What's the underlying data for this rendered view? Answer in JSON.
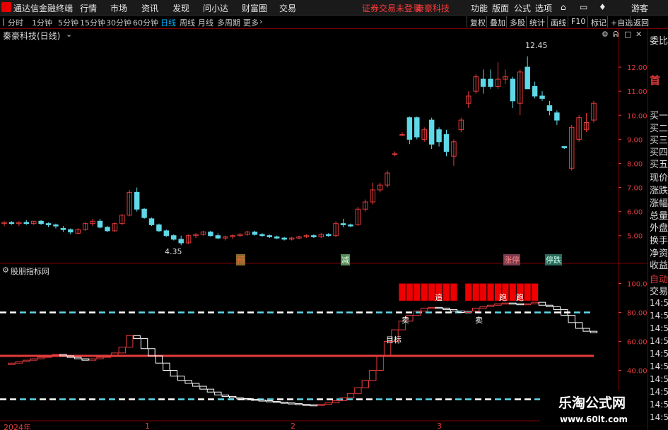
{
  "app_title": "通达信金融终端",
  "menu": [
    "行情",
    "市场",
    "资讯",
    "发现",
    "问小达",
    "财富圈",
    "交易"
  ],
  "notice": "证券交易未登录",
  "stock_title": "秦豪科技",
  "right_menu": [
    "功能",
    "版面",
    "公式",
    "选项"
  ],
  "guest": "游客",
  "periods": [
    "分时",
    "1分钟",
    "5分钟",
    "15分钟",
    "30分钟",
    "60分钟",
    "日线",
    "周线",
    "月线",
    "多周期",
    "更多"
  ],
  "active_period": "日线",
  "tool_buttons": [
    "复权",
    "叠加",
    "多股",
    "统计",
    "画线",
    "F10",
    "标记",
    "+自选",
    "返回"
  ],
  "chart_name": "秦豪科技(日线)",
  "indicator_name": "股朋指标网",
  "price_high_label": "12.45",
  "price_low_label": "4.35",
  "price_axis": [
    "12.00",
    "11.00",
    "10.00",
    "9.00",
    "8.00",
    "7.00",
    "6.00",
    "5.00"
  ],
  "ind_axis": [
    "100.0",
    "80.00",
    "60.00",
    "40.00"
  ],
  "events": [
    {
      "label": "预"
    },
    {
      "label": "减"
    },
    {
      "label": "涨停"
    },
    {
      "label": "停跌"
    }
  ],
  "signals": {
    "sell": "卖",
    "sell2": "卖",
    "target": "目标",
    "run": "跑",
    "run2": "跑",
    "chase": "追"
  },
  "time_axis": [
    "2024年",
    "1",
    "2",
    "3"
  ],
  "side_panel": [
    "委比",
    "首",
    "买一",
    "买二",
    "买三",
    "买四",
    "买五",
    "现价",
    "涨跌",
    "涨幅",
    "总量",
    "外盘",
    "换手",
    "净资",
    "收益",
    "自动",
    "交易",
    "14:5",
    "14:5",
    "14:5",
    "14:5",
    "14:5",
    "14:5",
    "14:5",
    "14:5",
    "14:5",
    "14:5"
  ],
  "watermark": {
    "name": "乐淘公式网",
    "url": "www.60lt.com"
  },
  "colors": {
    "up": "#e43b3b",
    "down": "#5fd8e8",
    "bg": "#000000",
    "grid": "#7a0000",
    "active": "#00b4ff"
  },
  "chart_data": {
    "type": "candlestick",
    "ylim": [
      4.2,
      13.0
    ],
    "candles": [
      [
        5.5,
        5.6,
        5.4,
        5.55
      ],
      [
        5.55,
        5.6,
        5.45,
        5.5
      ],
      [
        5.5,
        5.6,
        5.4,
        5.55
      ],
      [
        5.55,
        5.65,
        5.45,
        5.5
      ],
      [
        5.5,
        5.6,
        5.45,
        5.6
      ],
      [
        5.6,
        5.65,
        5.45,
        5.5
      ],
      [
        5.5,
        5.55,
        5.35,
        5.45
      ],
      [
        5.45,
        5.5,
        5.3,
        5.4
      ],
      [
        5.3,
        5.4,
        5.15,
        5.25
      ],
      [
        5.25,
        5.3,
        5.05,
        5.15
      ],
      [
        5.1,
        5.3,
        5.05,
        5.25
      ],
      [
        5.25,
        5.55,
        5.2,
        5.5
      ],
      [
        5.5,
        5.7,
        5.4,
        5.6
      ],
      [
        5.6,
        5.7,
        5.3,
        5.35
      ],
      [
        5.35,
        5.4,
        5.15,
        5.2
      ],
      [
        5.2,
        5.55,
        5.15,
        5.5
      ],
      [
        5.5,
        5.9,
        5.45,
        5.85
      ],
      [
        5.85,
        6.9,
        5.8,
        6.8
      ],
      [
        6.8,
        7.0,
        6.0,
        6.1
      ],
      [
        6.1,
        6.15,
        5.7,
        5.75
      ],
      [
        5.7,
        5.75,
        5.4,
        5.45
      ],
      [
        5.45,
        5.5,
        5.15,
        5.2
      ],
      [
        5.2,
        5.25,
        4.95,
        5.0
      ],
      [
        5.0,
        5.05,
        4.8,
        4.85
      ],
      [
        4.85,
        5.0,
        4.6,
        4.7
      ],
      [
        4.7,
        5.05,
        4.65,
        5.0
      ],
      [
        5.0,
        5.1,
        4.9,
        5.05
      ],
      [
        5.05,
        5.2,
        5.0,
        5.15
      ],
      [
        5.15,
        5.2,
        4.95,
        5.0
      ],
      [
        5.0,
        5.1,
        4.85,
        4.9
      ],
      [
        4.9,
        5.0,
        4.8,
        4.95
      ],
      [
        4.95,
        5.05,
        4.85,
        5.0
      ],
      [
        5.0,
        5.1,
        4.95,
        5.05
      ],
      [
        5.05,
        5.2,
        5.0,
        5.15
      ],
      [
        5.15,
        5.2,
        5.0,
        5.05
      ],
      [
        5.05,
        5.1,
        4.95,
        5.0
      ],
      [
        5.0,
        5.05,
        4.9,
        4.95
      ],
      [
        4.95,
        5.0,
        4.85,
        4.9
      ],
      [
        4.9,
        4.95,
        4.8,
        4.85
      ],
      [
        4.85,
        4.95,
        4.8,
        4.9
      ],
      [
        4.9,
        5.0,
        4.85,
        4.95
      ],
      [
        4.95,
        5.05,
        4.9,
        5.0
      ],
      [
        5.0,
        5.05,
        4.9,
        4.95
      ],
      [
        4.95,
        5.1,
        4.9,
        5.05
      ],
      [
        5.05,
        5.1,
        4.95,
        5.0
      ],
      [
        5.0,
        5.6,
        4.95,
        5.5
      ],
      [
        5.5,
        5.7,
        5.35,
        5.45
      ],
      [
        5.45,
        5.5,
        5.35,
        5.4
      ],
      [
        5.45,
        6.2,
        5.4,
        6.1
      ],
      [
        6.1,
        6.5,
        6.0,
        6.4
      ],
      [
        6.4,
        7.2,
        6.3,
        6.9
      ],
      [
        6.9,
        7.2,
        6.8,
        7.1
      ],
      [
        7.1,
        7.7,
        7.0,
        7.6
      ],
      [
        8.4,
        8.5,
        8.3,
        8.4
      ],
      [
        9.2,
        9.3,
        9.15,
        9.2
      ],
      [
        9.9,
        9.95,
        8.8,
        9.0
      ],
      [
        9.9,
        9.95,
        9.0,
        9.1
      ],
      [
        9.0,
        9.5,
        8.9,
        9.4
      ],
      [
        9.8,
        9.9,
        8.6,
        8.8
      ],
      [
        9.4,
        9.5,
        8.7,
        8.9
      ],
      [
        9.2,
        9.4,
        8.3,
        8.5
      ],
      [
        8.3,
        9.0,
        7.9,
        8.9
      ],
      [
        9.4,
        9.9,
        9.3,
        9.8
      ],
      [
        10.5,
        11.0,
        10.3,
        10.8
      ],
      [
        11.0,
        11.7,
        10.9,
        11.6
      ],
      [
        11.5,
        11.9,
        10.9,
        11.2
      ],
      [
        11.5,
        11.9,
        11.1,
        11.2
      ],
      [
        11.2,
        12.2,
        11.1,
        11.5
      ],
      [
        11.5,
        11.9,
        11.3,
        11.6
      ],
      [
        11.5,
        11.6,
        10.3,
        10.6
      ],
      [
        10.5,
        11.9,
        10.0,
        11.8
      ],
      [
        12.0,
        12.45,
        11.1,
        11.1
      ],
      [
        11.2,
        11.4,
        10.7,
        10.8
      ],
      [
        10.8,
        11.0,
        10.6,
        10.7
      ],
      [
        10.4,
        10.6,
        10.0,
        10.2
      ],
      [
        10.1,
        10.2,
        9.6,
        9.8
      ],
      [
        8.7,
        8.7,
        8.6,
        8.65
      ],
      [
        7.8,
        9.6,
        7.7,
        9.5
      ],
      [
        9.0,
        10.0,
        8.9,
        9.9
      ],
      [
        9.4,
        10.1,
        9.3,
        9.7
      ],
      [
        9.8,
        10.6,
        9.7,
        10.5
      ]
    ],
    "indicator": [
      44,
      45,
      46,
      47,
      48,
      49,
      50,
      51,
      50,
      49,
      48,
      47,
      48,
      49,
      50,
      52,
      56,
      64,
      62,
      55,
      50,
      45,
      40,
      36,
      33,
      31,
      29,
      27,
      25,
      23,
      22,
      21,
      20.5,
      20,
      19.5,
      19,
      18.5,
      18,
      17.5,
      17,
      16.5,
      16.2,
      16,
      16.5,
      17.5,
      19,
      21,
      24,
      28,
      33,
      40,
      50,
      60,
      68,
      74,
      78,
      81,
      83,
      83.5,
      83,
      82,
      81,
      80,
      81,
      83,
      84,
      85,
      86,
      86.5,
      86,
      85.5,
      86,
      87,
      85,
      84,
      82,
      78,
      73,
      69,
      67,
      66
    ],
    "indicator_ylim": [
      10,
      110
    ]
  }
}
